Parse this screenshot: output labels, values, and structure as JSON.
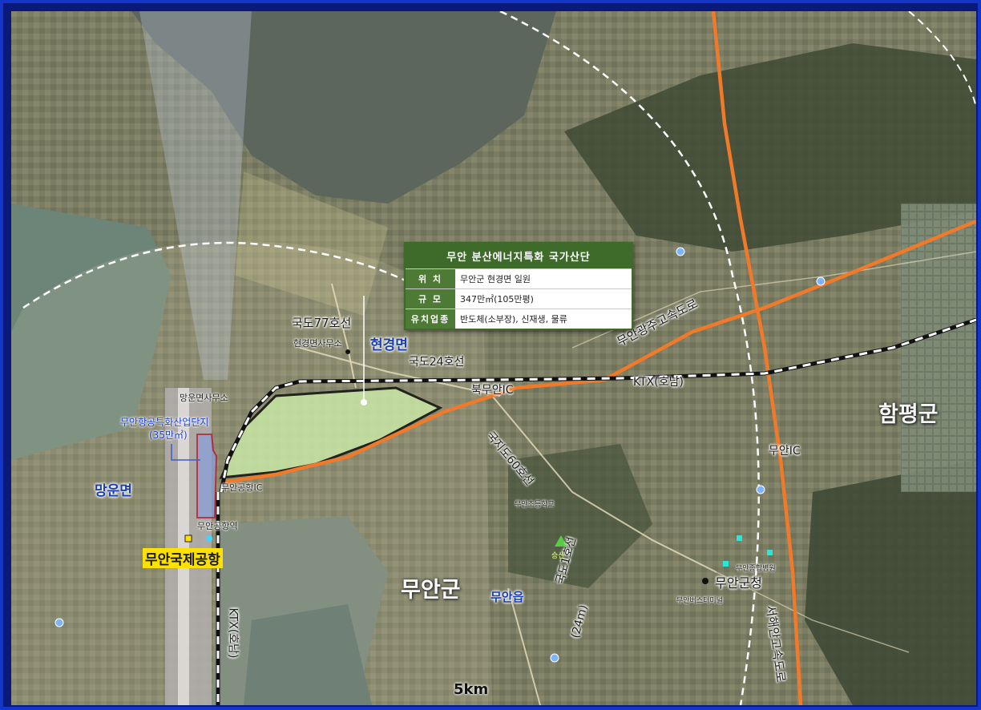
{
  "popup": {
    "title": "무안 분산에너지특화 국가산단",
    "rows": [
      {
        "key": "위    치",
        "value": "무안군 현경면 일원"
      },
      {
        "key": "규    모",
        "value": "347만㎡(105만평)"
      },
      {
        "key": "유치업종",
        "value": "반도체(소부장), 신재생, 물류"
      }
    ]
  },
  "labels": {
    "road77": "국도77호선",
    "hyeongyeong_office": "현경면사무소",
    "hyeongyeong": "현경면",
    "road24": "국도24호선",
    "bukmuan_ic": "북무안IC",
    "ktx_honam": "KTX(호남)",
    "expressway_muan_gwangju": "무안광주고속도로",
    "hampyeong": "함평군",
    "road60": "국지도60호선",
    "muan_ic": "무안IC",
    "mangun_office": "망운면사무소",
    "airport_complex": "무안항공특화산업단지",
    "airport_complex_size": "(35만㎡)",
    "airport_ic": "무안공항IC",
    "mangun": "망운면",
    "airport_station": "무안공항역",
    "muan_airport": "무안국제공항",
    "ktx_vertical": "KTX(호남)",
    "muan_gun": "무안군",
    "muan_eup": "무안읍",
    "local_road1": "국도1호선",
    "local_road1_width": "(24m)",
    "muan_county_office": "무안군청",
    "seohaean_expressway": "서해안고속도로",
    "radius": "5km",
    "seungdal": "승산",
    "muan_elementary": "무안초등학교",
    "muan_terminal": "무안버스터미널",
    "hospital": "무안종합병원"
  },
  "colors": {
    "frame": "#1436c8",
    "expressway": "#f07a2a",
    "site_fill": "#c9e7a6",
    "popup_green": "#3e6b2a",
    "airport_zone": "#c0102a"
  }
}
